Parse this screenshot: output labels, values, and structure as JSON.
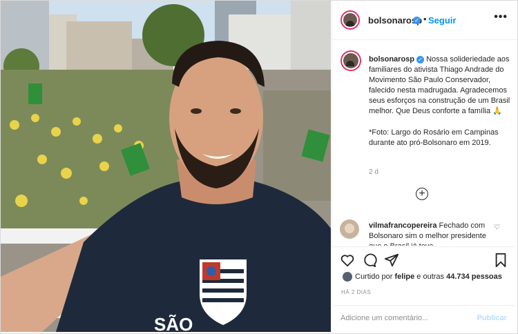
{
  "post": {
    "username": "bolsonarosp",
    "verified_mark": "✓",
    "dot": "•",
    "follow_label": "Seguir",
    "more_label": "•••",
    "caption_text": "Nossa solideriedade aos familiares do ativista Thiago Andrade do Movimento São Paulo Conservador, falecido nesta madrugada. Agradecemos seus esforços na construção de um Brasil melhor. Que Deus conforte a família 🙏",
    "caption_foto": "*Foto: Largo do Rosário em Campinas durante ato pró-Bolsonaro em 2019.",
    "caption_time": "2 d",
    "load_more": "+"
  },
  "comment": {
    "username": "vilmafrancopereira",
    "text": "Fechado com Bolsonaro sim o melhor presidente que o Brasil já teve",
    "heart": "♡"
  },
  "actions": {
    "icons": [
      "heart-icon",
      "comment-icon",
      "share-icon",
      "bookmark-icon"
    ],
    "liked_prefix": "Curtido por",
    "liked_user": "felipe",
    "liked_mid": "e outras",
    "liked_count": "44.734 pessoas",
    "time_ago": "HÁ 2 DIAS",
    "comment_placeholder": "Adicione um comentário...",
    "publish_label": "Publicar"
  },
  "photo": {
    "shirt_text": "SÃO"
  },
  "colors": {
    "accent": "#0095f6",
    "verified": "#3897f0",
    "muted": "#8e8e8e",
    "publish_disabled": "#b2dffc"
  }
}
